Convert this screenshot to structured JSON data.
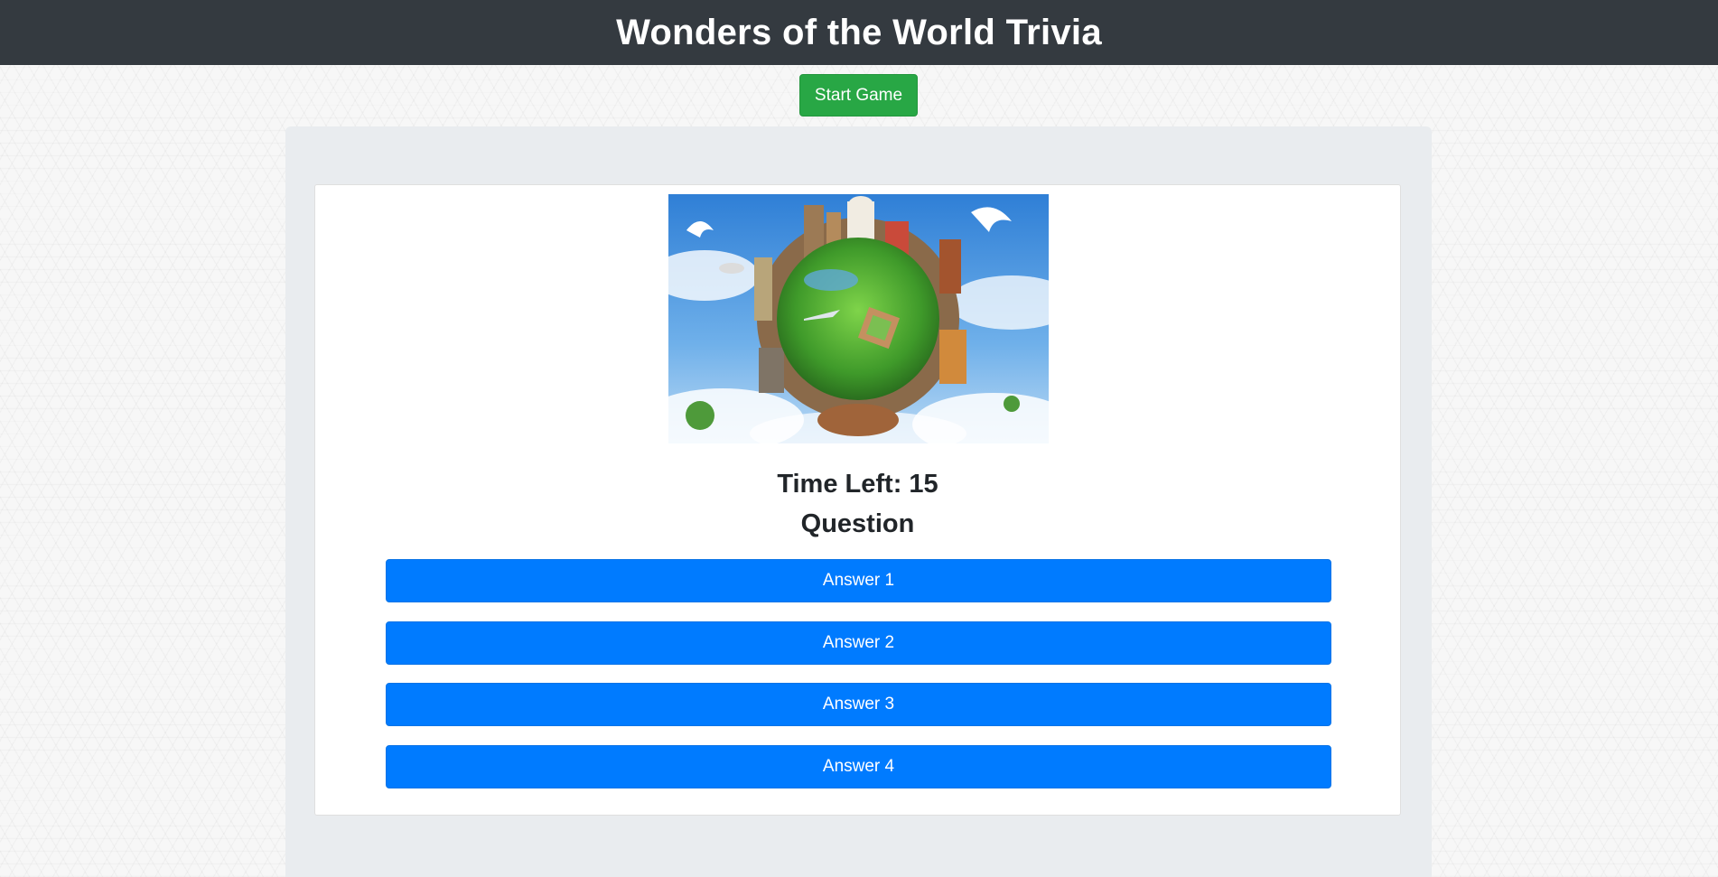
{
  "header": {
    "title": "Wonders of the World Trivia"
  },
  "controls": {
    "start_label": "Start Game"
  },
  "game": {
    "timer_text": "Time Left: 15",
    "question_text": "Question",
    "answers": [
      "Answer 1",
      "Answer 2",
      "Answer 3",
      "Answer 4"
    ]
  },
  "image": {
    "subject": "globe collage of world landmarks in the sky"
  },
  "colors": {
    "header_bg": "#343a40",
    "start_button": "#28a745",
    "answer_button": "#007bff",
    "panel_bg": "#e9ecef",
    "card_bg": "#ffffff"
  }
}
